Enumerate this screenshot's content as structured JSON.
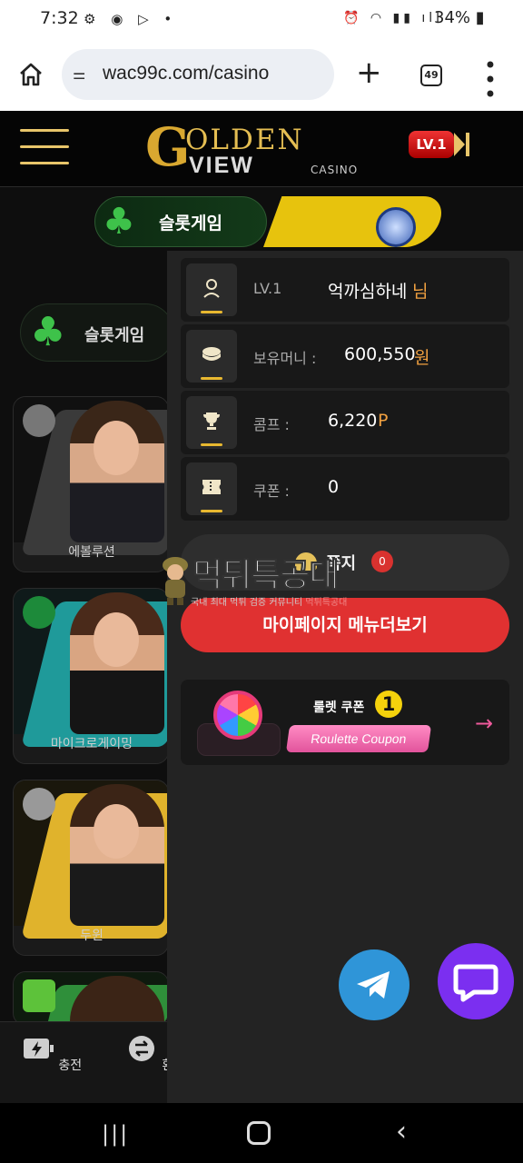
{
  "status_bar": {
    "time": "7:32",
    "battery": "34%"
  },
  "browser": {
    "url": "wac99c.com/casino",
    "tab_count": "49"
  },
  "site": {
    "logo_g": "G",
    "logo_olden": "OLDEN",
    "logo_view": "VIEW",
    "logo_casino": "CASINO",
    "level_badge": "LV.1"
  },
  "game_tabs": {
    "slot_label": "슬롯게임"
  },
  "sidebar": {
    "slot_pill_label": "슬롯게임",
    "cards": [
      {
        "name": "에볼루션"
      },
      {
        "name": "마이크로게이밍"
      },
      {
        "name": "두윈"
      },
      {
        "name": ""
      }
    ],
    "bottom": [
      {
        "label": "충전"
      },
      {
        "label": "환전"
      }
    ]
  },
  "panel": {
    "level_key": "LV.1",
    "username": "억까심하네",
    "username_suffix": "님",
    "money_key": "보유머니 :",
    "money_value": "600,550",
    "money_unit": "원",
    "comp_key": "콤프 :",
    "comp_value": "6,220",
    "comp_unit": "P",
    "coupon_key": "쿠폰 :",
    "coupon_value": "0",
    "notice_label": "쪽지",
    "notice_count": "0",
    "mypage_button": "마이페이지 메뉴더보기",
    "roulette_title": "룰렛 쿠폰",
    "roulette_count": "1",
    "roulette_pill": "Roulette Coupon"
  },
  "watermark": {
    "title": "먹튀특공대",
    "subtitle_main": "국내 최대 먹튀 검증 커뮤니티",
    "subtitle_brand": "먹튀특공대"
  }
}
